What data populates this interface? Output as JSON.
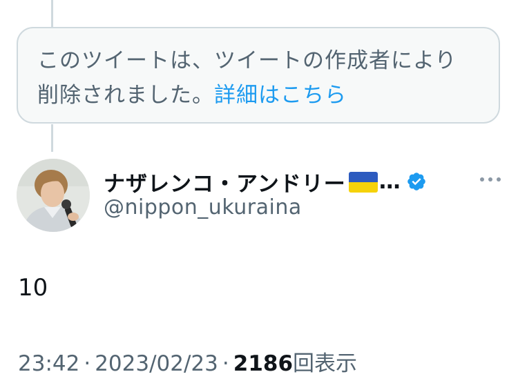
{
  "deleted_notice": {
    "line1": "このツイートは、ツイートの作成者により",
    "line2_prefix": "削除されました。",
    "details_link": "詳細はこちら"
  },
  "author": {
    "name": "ナザレンコ・アンドリー",
    "name_suffix": "…",
    "handle": "@nippon_ukuraina",
    "flag_icon": "ukraine-flag-emoji",
    "verified_icon": "verified-badge-icon"
  },
  "tweet": {
    "text": "10"
  },
  "meta": {
    "time": "23:42",
    "separator": "·",
    "date": "2023/02/23",
    "views_count": "2186",
    "views_label": "回表示"
  },
  "colors": {
    "accent": "#1d9bf0",
    "secondary_text": "#536471",
    "primary_text": "#0f1419",
    "notice_bg": "#f7f9f9",
    "border": "#cfd9de",
    "flag_blue": "#2d5bbf",
    "flag_yellow": "#f5d20a"
  }
}
